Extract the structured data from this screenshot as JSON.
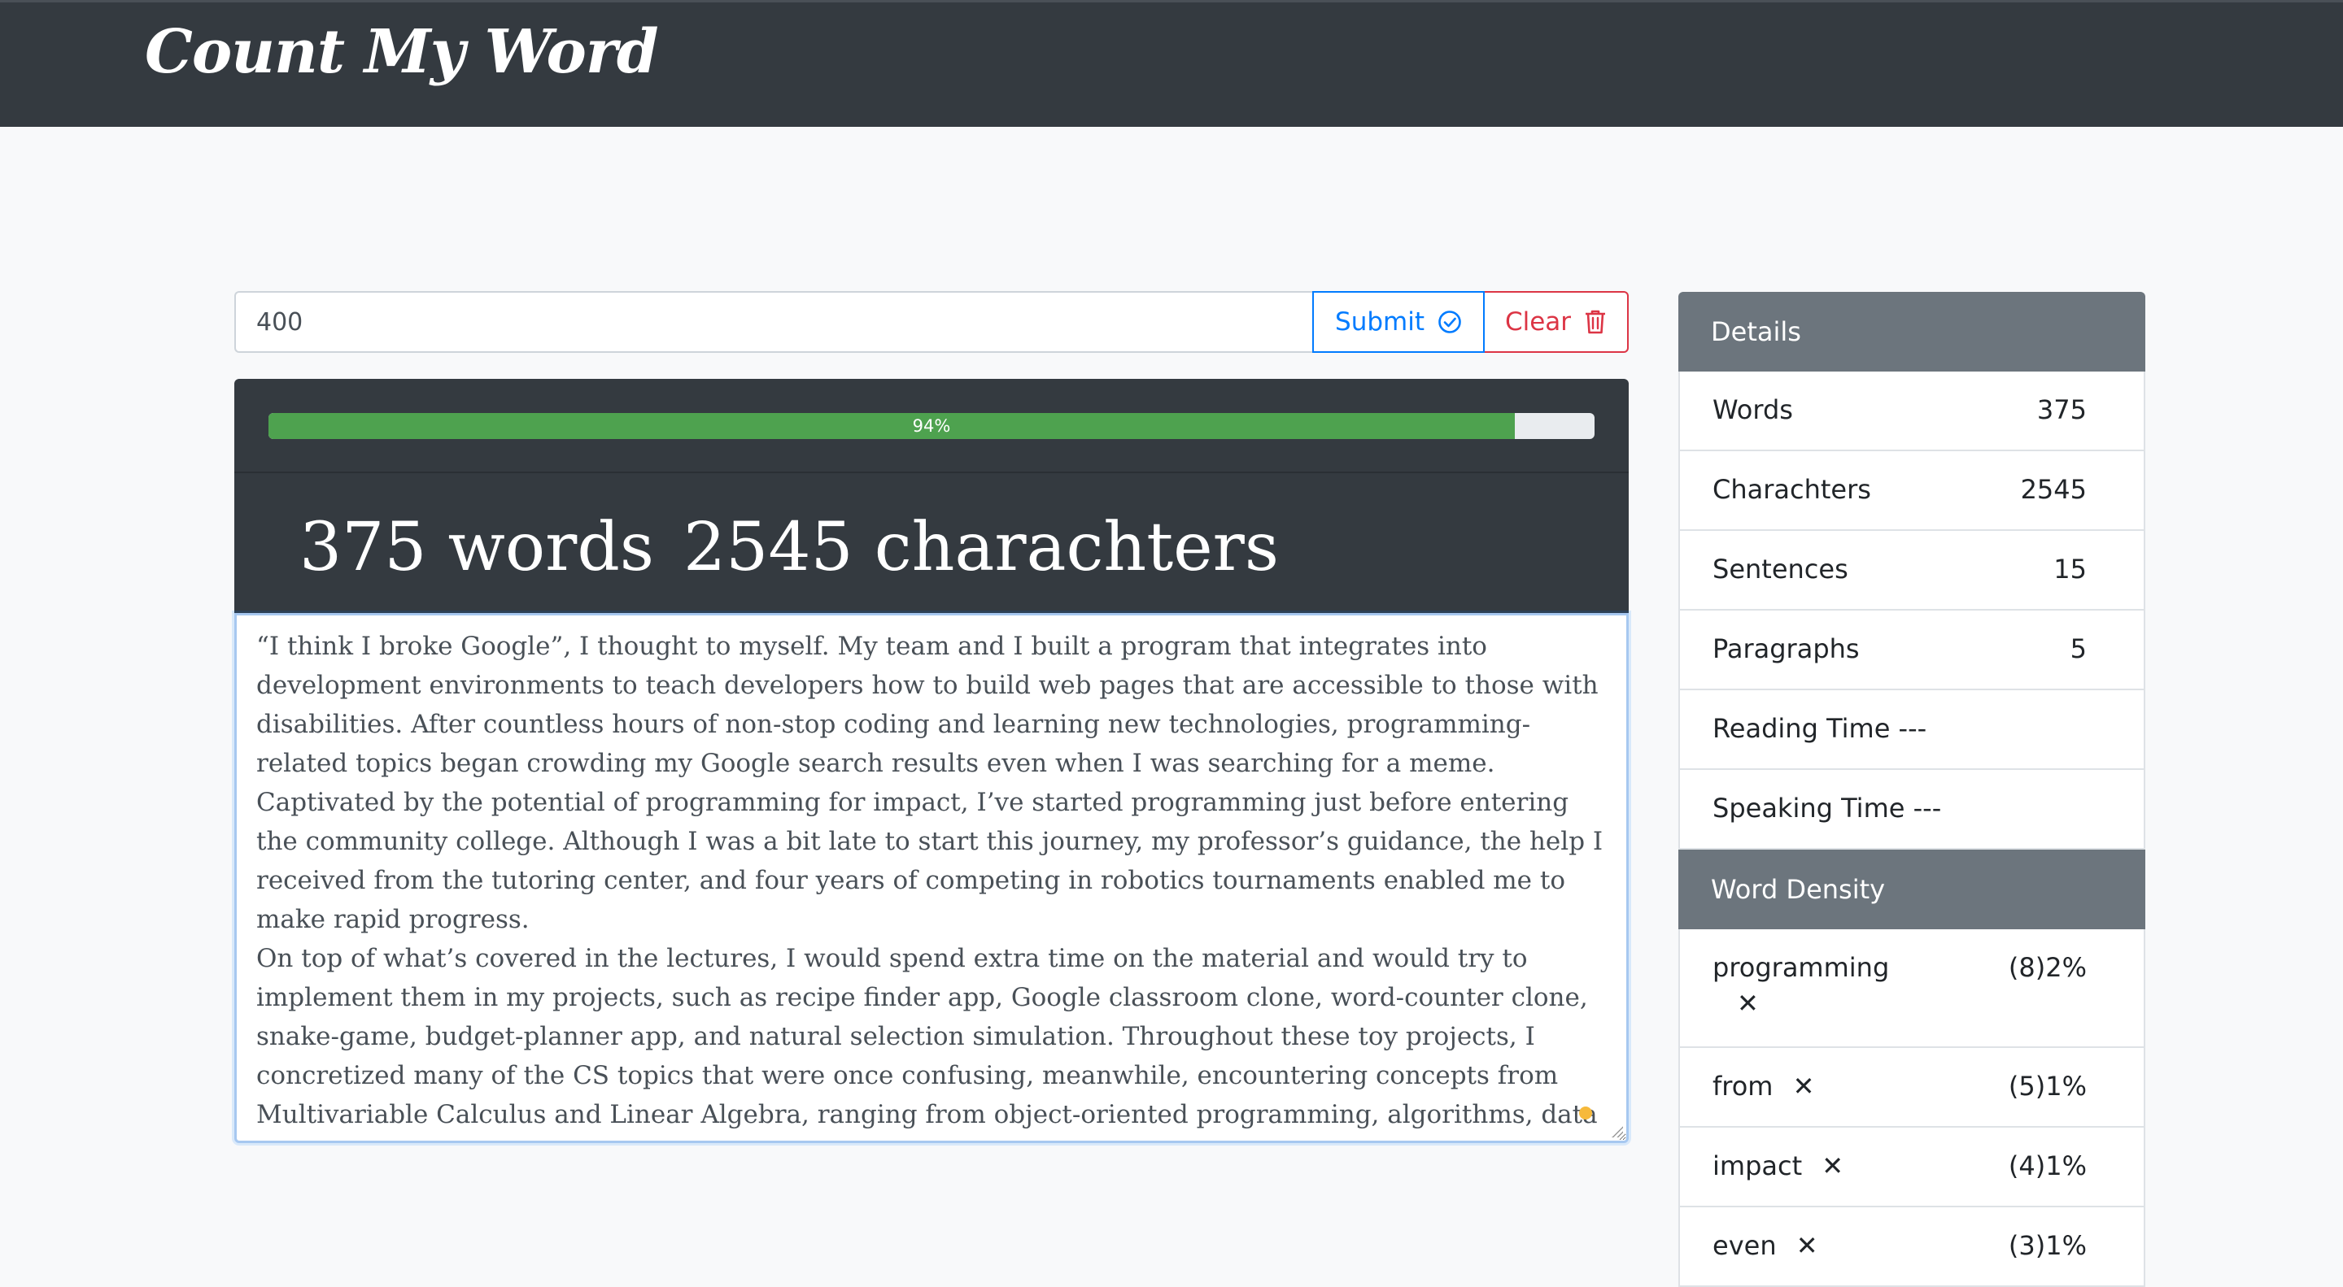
{
  "app": {
    "title": "Count My Word"
  },
  "limit": {
    "value": "400"
  },
  "buttons": {
    "submit": "Submit",
    "submit_icon": "check-circle-icon",
    "clear": "Clear",
    "clear_icon": "trash-icon"
  },
  "progress": {
    "percent": 94,
    "label": "94%"
  },
  "stats": {
    "words": "375 words",
    "characters": "2545 charachters"
  },
  "editor": {
    "paragraphs": [
      "“I think I broke Google”, I thought to myself. My team and I built a program that integrates into development environments to teach developers how to build web pages that are accessible to those with disabilities. After countless hours of non-stop coding and learning new technologies, programming-related topics began crowding my Google search results even when I was searching for a meme.",
      "Captivated by the potential of programming for impact, I’ve started programming just before entering the community college. Although I was a bit late to start this journey, my professor’s guidance, the help I received from the tutoring center, and four years of competing in robotics tournaments enabled me to make rapid progress.",
      "On top of what’s covered in the lectures, I would spend extra time on the material and would try to implement them in my projects, such as recipe finder app, Google classroom clone, word-counter clone, snake-game, budget-planner app, and natural selection simulation. Throughout these toy projects, I concretized many of the CS topics that were once confusing, meanwhile, encountering concepts from Multivariable Calculus and Linear Algebra, ranging from object-oriented programming, algorithms, data structures to vectors and even"
    ]
  },
  "details": {
    "header": "Details",
    "rows": [
      {
        "label": "Words",
        "value": "375"
      },
      {
        "label": "Charachters",
        "value": "2545"
      },
      {
        "label": "Sentences",
        "value": "15"
      },
      {
        "label": "Paragraphs",
        "value": "5"
      },
      {
        "label": "Reading Time ---",
        "value": ""
      },
      {
        "label": "Speaking Time ---",
        "value": ""
      }
    ]
  },
  "density": {
    "header": "Word Density",
    "remove_icon": "close-x-icon",
    "rows": [
      {
        "word": "programming",
        "pct": "(8)2%"
      },
      {
        "word": "from",
        "pct": "(5)1%"
      },
      {
        "word": "impact",
        "pct": "(4)1%"
      },
      {
        "word": "even",
        "pct": "(3)1%"
      }
    ]
  },
  "colors": {
    "navbar": "#343a40",
    "submit": "#007bff",
    "clear": "#dc3545",
    "progress": "#4ea24f",
    "card_header": "#6c757d"
  }
}
